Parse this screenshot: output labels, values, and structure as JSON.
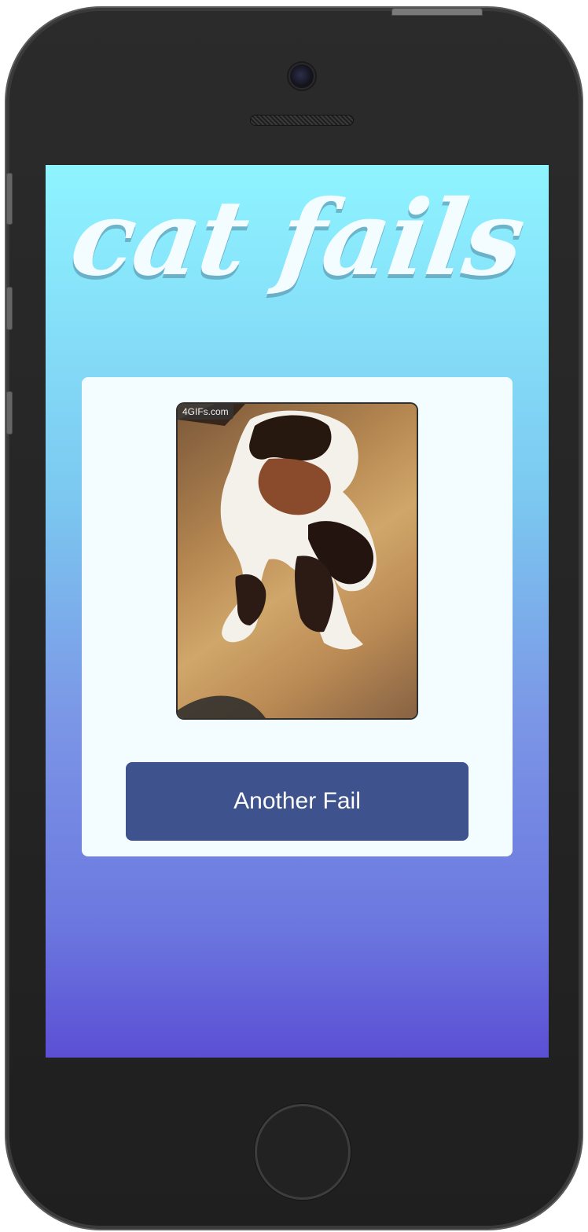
{
  "app": {
    "title": "cat fails"
  },
  "content": {
    "gif_label": "4GIFs.com",
    "cta_label": "Another Fail"
  },
  "icons": {
    "camera": "front-camera-icon",
    "speaker": "speaker-grille-icon",
    "home": "home-button-icon"
  },
  "colors": {
    "button_bg": "#3e538d",
    "card_bg": "#f3fcff",
    "gradient_top": "#8ef4ff",
    "gradient_bottom": "#5b4fd4"
  }
}
